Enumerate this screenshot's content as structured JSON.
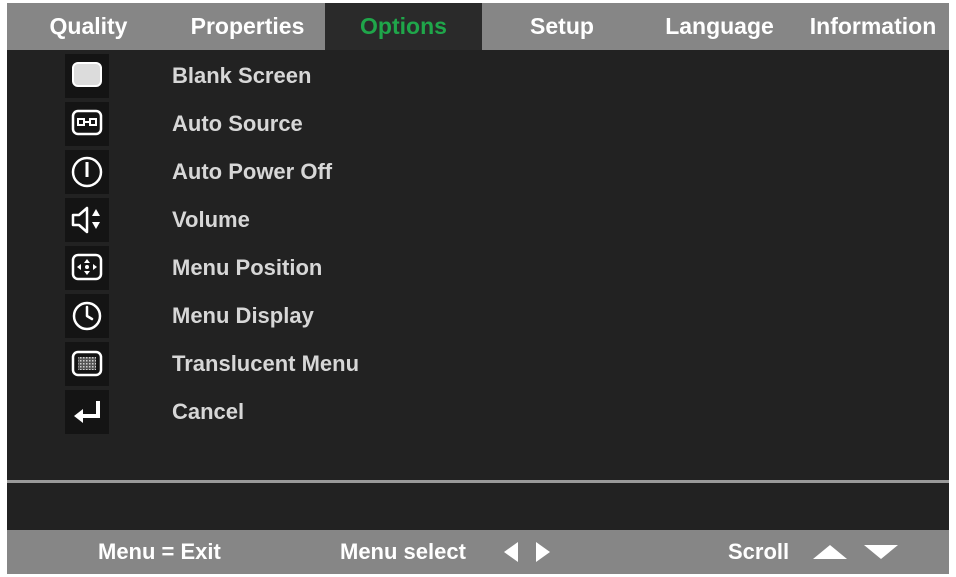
{
  "tabs": [
    {
      "label": "Quality"
    },
    {
      "label": "Properties"
    },
    {
      "label": "Options",
      "active": true
    },
    {
      "label": "Setup"
    },
    {
      "label": "Language"
    },
    {
      "label": "Information"
    }
  ],
  "menu": {
    "items": [
      {
        "label": "Blank Screen",
        "icon": "blank-screen-icon"
      },
      {
        "label": "Auto Source",
        "icon": "auto-source-icon"
      },
      {
        "label": "Auto Power Off",
        "icon": "power-icon"
      },
      {
        "label": "Volume",
        "icon": "volume-icon"
      },
      {
        "label": "Menu Position",
        "icon": "menu-position-icon"
      },
      {
        "label": "Menu Display",
        "icon": "clock-icon"
      },
      {
        "label": "Translucent Menu",
        "icon": "translucent-icon"
      },
      {
        "label": "Cancel",
        "icon": "enter-icon"
      }
    ]
  },
  "footer": {
    "exit_hint": "Menu = Exit",
    "select_hint": "Menu select",
    "scroll_hint": "Scroll"
  },
  "colors": {
    "background": "#222222",
    "tab_bar": "#868686",
    "active_tab_text": "#1fa64a",
    "item_text": "#d7d7d7"
  }
}
